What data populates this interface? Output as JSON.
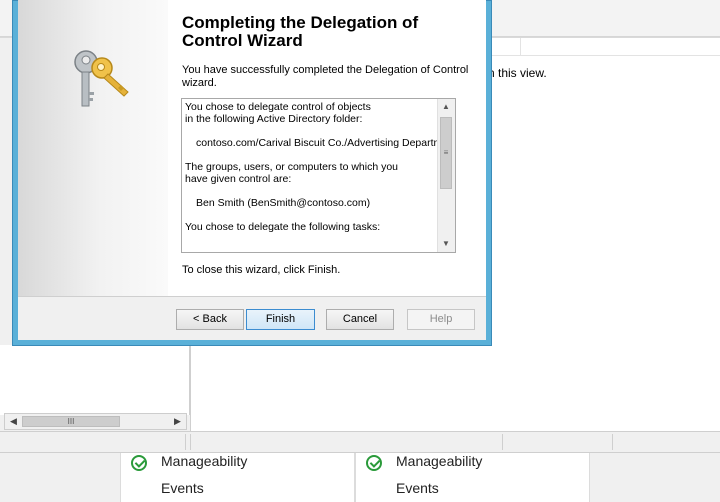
{
  "background": {
    "empty_view_text": "n this view.",
    "scroll_thumb_glyph": "III",
    "tiles": [
      {
        "status_label": "Manageability",
        "events_label": "Events"
      },
      {
        "status_label": "Manageability",
        "events_label": "Events"
      }
    ]
  },
  "wizard": {
    "title": "Completing the Delegation of Control Wizard",
    "intro": "You have successfully completed the Delegation of Control wizard.",
    "summary_lines": [
      "You chose to delegate control of objects",
      "in the following Active Directory folder:",
      "",
      "contoso.com/Carival Biscuit Co./Advertising Department",
      "",
      "The groups, users, or computers to which you",
      "have given control are:",
      "",
      "Ben Smith (BenSmith@contoso.com)",
      "",
      "You chose to delegate the following tasks:"
    ],
    "close_hint": "To close this wizard, click Finish.",
    "buttons": {
      "back": "< Back",
      "finish": "Finish",
      "cancel": "Cancel",
      "help": "Help"
    },
    "icon": "keys-icon"
  },
  "colors": {
    "dialog_border": "#5ab0d8",
    "status_ok": "#2a9a3a",
    "primary_button": "#3c8cd0"
  }
}
